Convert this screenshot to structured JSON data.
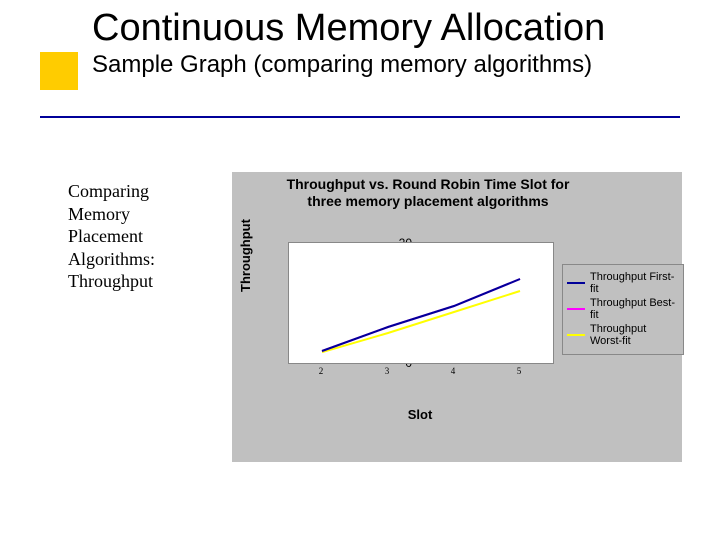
{
  "slide": {
    "title": "Continuous Memory Allocation",
    "subtitle": "Sample Graph (comparing memory algorithms)",
    "body": "Comparing Memory Placement Algorithms: Throughput"
  },
  "chart_data": {
    "type": "line",
    "title": "Throughput vs. Round Robin Time Slot for three memory placement algorithms",
    "xlabel": "Slot",
    "ylabel": "Throughput",
    "ylim": [
      0,
      20
    ],
    "yticks": [
      0,
      5,
      10,
      15,
      20
    ],
    "x": [
      2,
      3,
      4,
      5
    ],
    "series": [
      {
        "name": "Throughput First-fit",
        "color": "#000099",
        "values": [
          2.0,
          6.0,
          9.5,
          14.0
        ]
      },
      {
        "name": "Throughput Best-fit",
        "color": "#ff00ff",
        "values": [
          2.0,
          6.0,
          9.5,
          14.0
        ]
      },
      {
        "name": "Throughput Worst-fit",
        "color": "#ffff00",
        "values": [
          1.8,
          5.0,
          8.5,
          12.0
        ]
      }
    ]
  }
}
